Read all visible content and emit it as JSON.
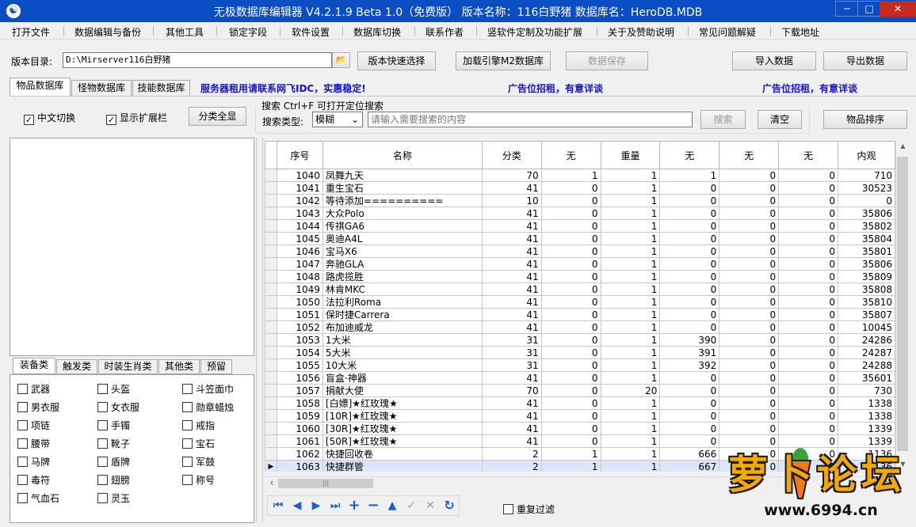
{
  "window": {
    "icon_glyph": "☯",
    "title": "无极数据库编辑器 V4.2.1.9   Beta 1.0（免费版）   版本名称：116白野猪     数据库名：HeroDB.MDB",
    "min": "─",
    "max": "□",
    "close": "✕"
  },
  "menu": [
    "打开文件",
    "数据编辑与备份",
    "其他工具",
    "锁定字段",
    "软件设置",
    "数据库切换",
    "联系作者",
    "竖软件定制及功能扩展",
    "关于及赞助说明",
    "常见问题解疑",
    "下载地址"
  ],
  "toolbar": {
    "dir_label": "版本目录:",
    "dir_value": "D:\\Mirserver116白野猪",
    "folder_icon": "📂",
    "quick_select": "版本快速选择",
    "load_engine": "加载引擎M2数据库",
    "save_data": "数据保存",
    "import_data": "导入数据",
    "export_data": "导出数据"
  },
  "tabs": [
    "物品数据库",
    "怪物数据库",
    "技能数据库"
  ],
  "ads": [
    "服务器租用请联系网飞IDC，实惠稳定!",
    "广告位招租，有意详谈",
    "广告位招租，有意详谈"
  ],
  "options": {
    "chinese_switch": "中文切换",
    "show_ext": "显示扩展栏",
    "check_mark": "✓",
    "category_all": "分类全显"
  },
  "search": {
    "group_title": "搜索  Ctrl+F 可打开定位搜索",
    "type_label": "搜索类型:",
    "type_value": "模糊",
    "placeholder": "请输入需要搜索的内容",
    "search_btn": "搜索",
    "clear_btn": "清空",
    "sort_btn": "物品排序"
  },
  "category_tabs": [
    "装备类",
    "触发类",
    "时装生肖类",
    "其他类",
    "预留"
  ],
  "categories": [
    "武器",
    "头盔",
    "斗笠面巾",
    "男衣服",
    "女衣服",
    "勋章蜡烛",
    "项链",
    "手镯",
    "戒指",
    "腰带",
    "靴子",
    "宝石",
    "马牌",
    "盾牌",
    "军鼓",
    "毒符",
    "翅膀",
    "称号",
    "气血石",
    "灵玉"
  ],
  "grid": {
    "columns": [
      "序号",
      "名称",
      "分类",
      "无",
      "重量",
      "无",
      "无",
      "无",
      "内观"
    ],
    "rows": [
      [
        "1040",
        "凤舞九天",
        "70",
        "1",
        "1",
        "1",
        "0",
        "0",
        "710"
      ],
      [
        "1041",
        "重生宝石",
        "41",
        "0",
        "1",
        "0",
        "0",
        "0",
        "30523"
      ],
      [
        "1042",
        "等待添加==========",
        "10",
        "0",
        "1",
        "0",
        "0",
        "0",
        "0"
      ],
      [
        "1043",
        "大众Polo",
        "41",
        "0",
        "1",
        "0",
        "0",
        "0",
        "35806"
      ],
      [
        "1044",
        "传祺GA6",
        "41",
        "0",
        "1",
        "0",
        "0",
        "0",
        "35802"
      ],
      [
        "1045",
        "奥迪A4L",
        "41",
        "0",
        "1",
        "0",
        "0",
        "0",
        "35804"
      ],
      [
        "1046",
        "宝马X6",
        "41",
        "0",
        "1",
        "0",
        "0",
        "0",
        "35801"
      ],
      [
        "1047",
        "奔驰GLA",
        "41",
        "0",
        "1",
        "0",
        "0",
        "0",
        "35806"
      ],
      [
        "1048",
        "路虎揽胜",
        "41",
        "0",
        "1",
        "0",
        "0",
        "0",
        "35809"
      ],
      [
        "1049",
        "林肯MKC",
        "41",
        "0",
        "1",
        "0",
        "0",
        "0",
        "35808"
      ],
      [
        "1050",
        "法拉利Roma",
        "41",
        "0",
        "1",
        "0",
        "0",
        "0",
        "35810"
      ],
      [
        "1051",
        "保时捷Carrera",
        "41",
        "0",
        "1",
        "0",
        "0",
        "0",
        "35807"
      ],
      [
        "1052",
        "布加迪威龙",
        "41",
        "0",
        "1",
        "0",
        "0",
        "0",
        "10045"
      ],
      [
        "1053",
        "1大米",
        "31",
        "0",
        "1",
        "390",
        "0",
        "0",
        "24286"
      ],
      [
        "1054",
        "5大米",
        "31",
        "0",
        "1",
        "391",
        "0",
        "0",
        "24287"
      ],
      [
        "1055",
        "10大米",
        "31",
        "0",
        "1",
        "392",
        "0",
        "0",
        "24288"
      ],
      [
        "1056",
        "盲盒·神器",
        "41",
        "0",
        "1",
        "0",
        "0",
        "0",
        "35601"
      ],
      [
        "1057",
        "捐献大使",
        "70",
        "0",
        "20",
        "0",
        "0",
        "0",
        "730"
      ],
      [
        "1058",
        "[白嫖]★红玫瑰★",
        "41",
        "0",
        "1",
        "0",
        "0",
        "0",
        "1338"
      ],
      [
        "1059",
        "[10R]★红玫瑰★",
        "41",
        "0",
        "1",
        "0",
        "0",
        "0",
        "1338"
      ],
      [
        "1060",
        "[30R]★红玫瑰★",
        "41",
        "0",
        "1",
        "0",
        "0",
        "0",
        "1339"
      ],
      [
        "1061",
        "[50R]★红玫瑰★",
        "41",
        "0",
        "1",
        "0",
        "0",
        "0",
        "1339"
      ],
      [
        "1062",
        "快捷回收卷",
        "2",
        "1",
        "1",
        "666",
        "0",
        "0",
        "1136"
      ],
      [
        "1063",
        "快捷群管",
        "2",
        "1",
        "1",
        "667",
        "0",
        "0",
        "1136"
      ]
    ],
    "current_marker": "▶"
  },
  "scroll": {
    "up": "▲",
    "down": "▼",
    "left": "‹",
    "right": "›",
    "grip": "|||"
  },
  "nav": {
    "first": "⏮",
    "prior": "◀",
    "next": "▶",
    "last": "⏭",
    "insert": "+",
    "delete": "−",
    "edit": "▲",
    "post": "✓",
    "cancel": "✕",
    "refresh": "↻"
  },
  "repeat_filter": "重复过滤",
  "watermark": {
    "logo": "萝卜论坛",
    "url": "www.6994.cn"
  },
  "colors": {
    "titlebar": "#0b4ec3",
    "ad_text": "#1515c8",
    "nav_icon": "#1a5fd6",
    "watermark_orange": "#f5a800"
  }
}
